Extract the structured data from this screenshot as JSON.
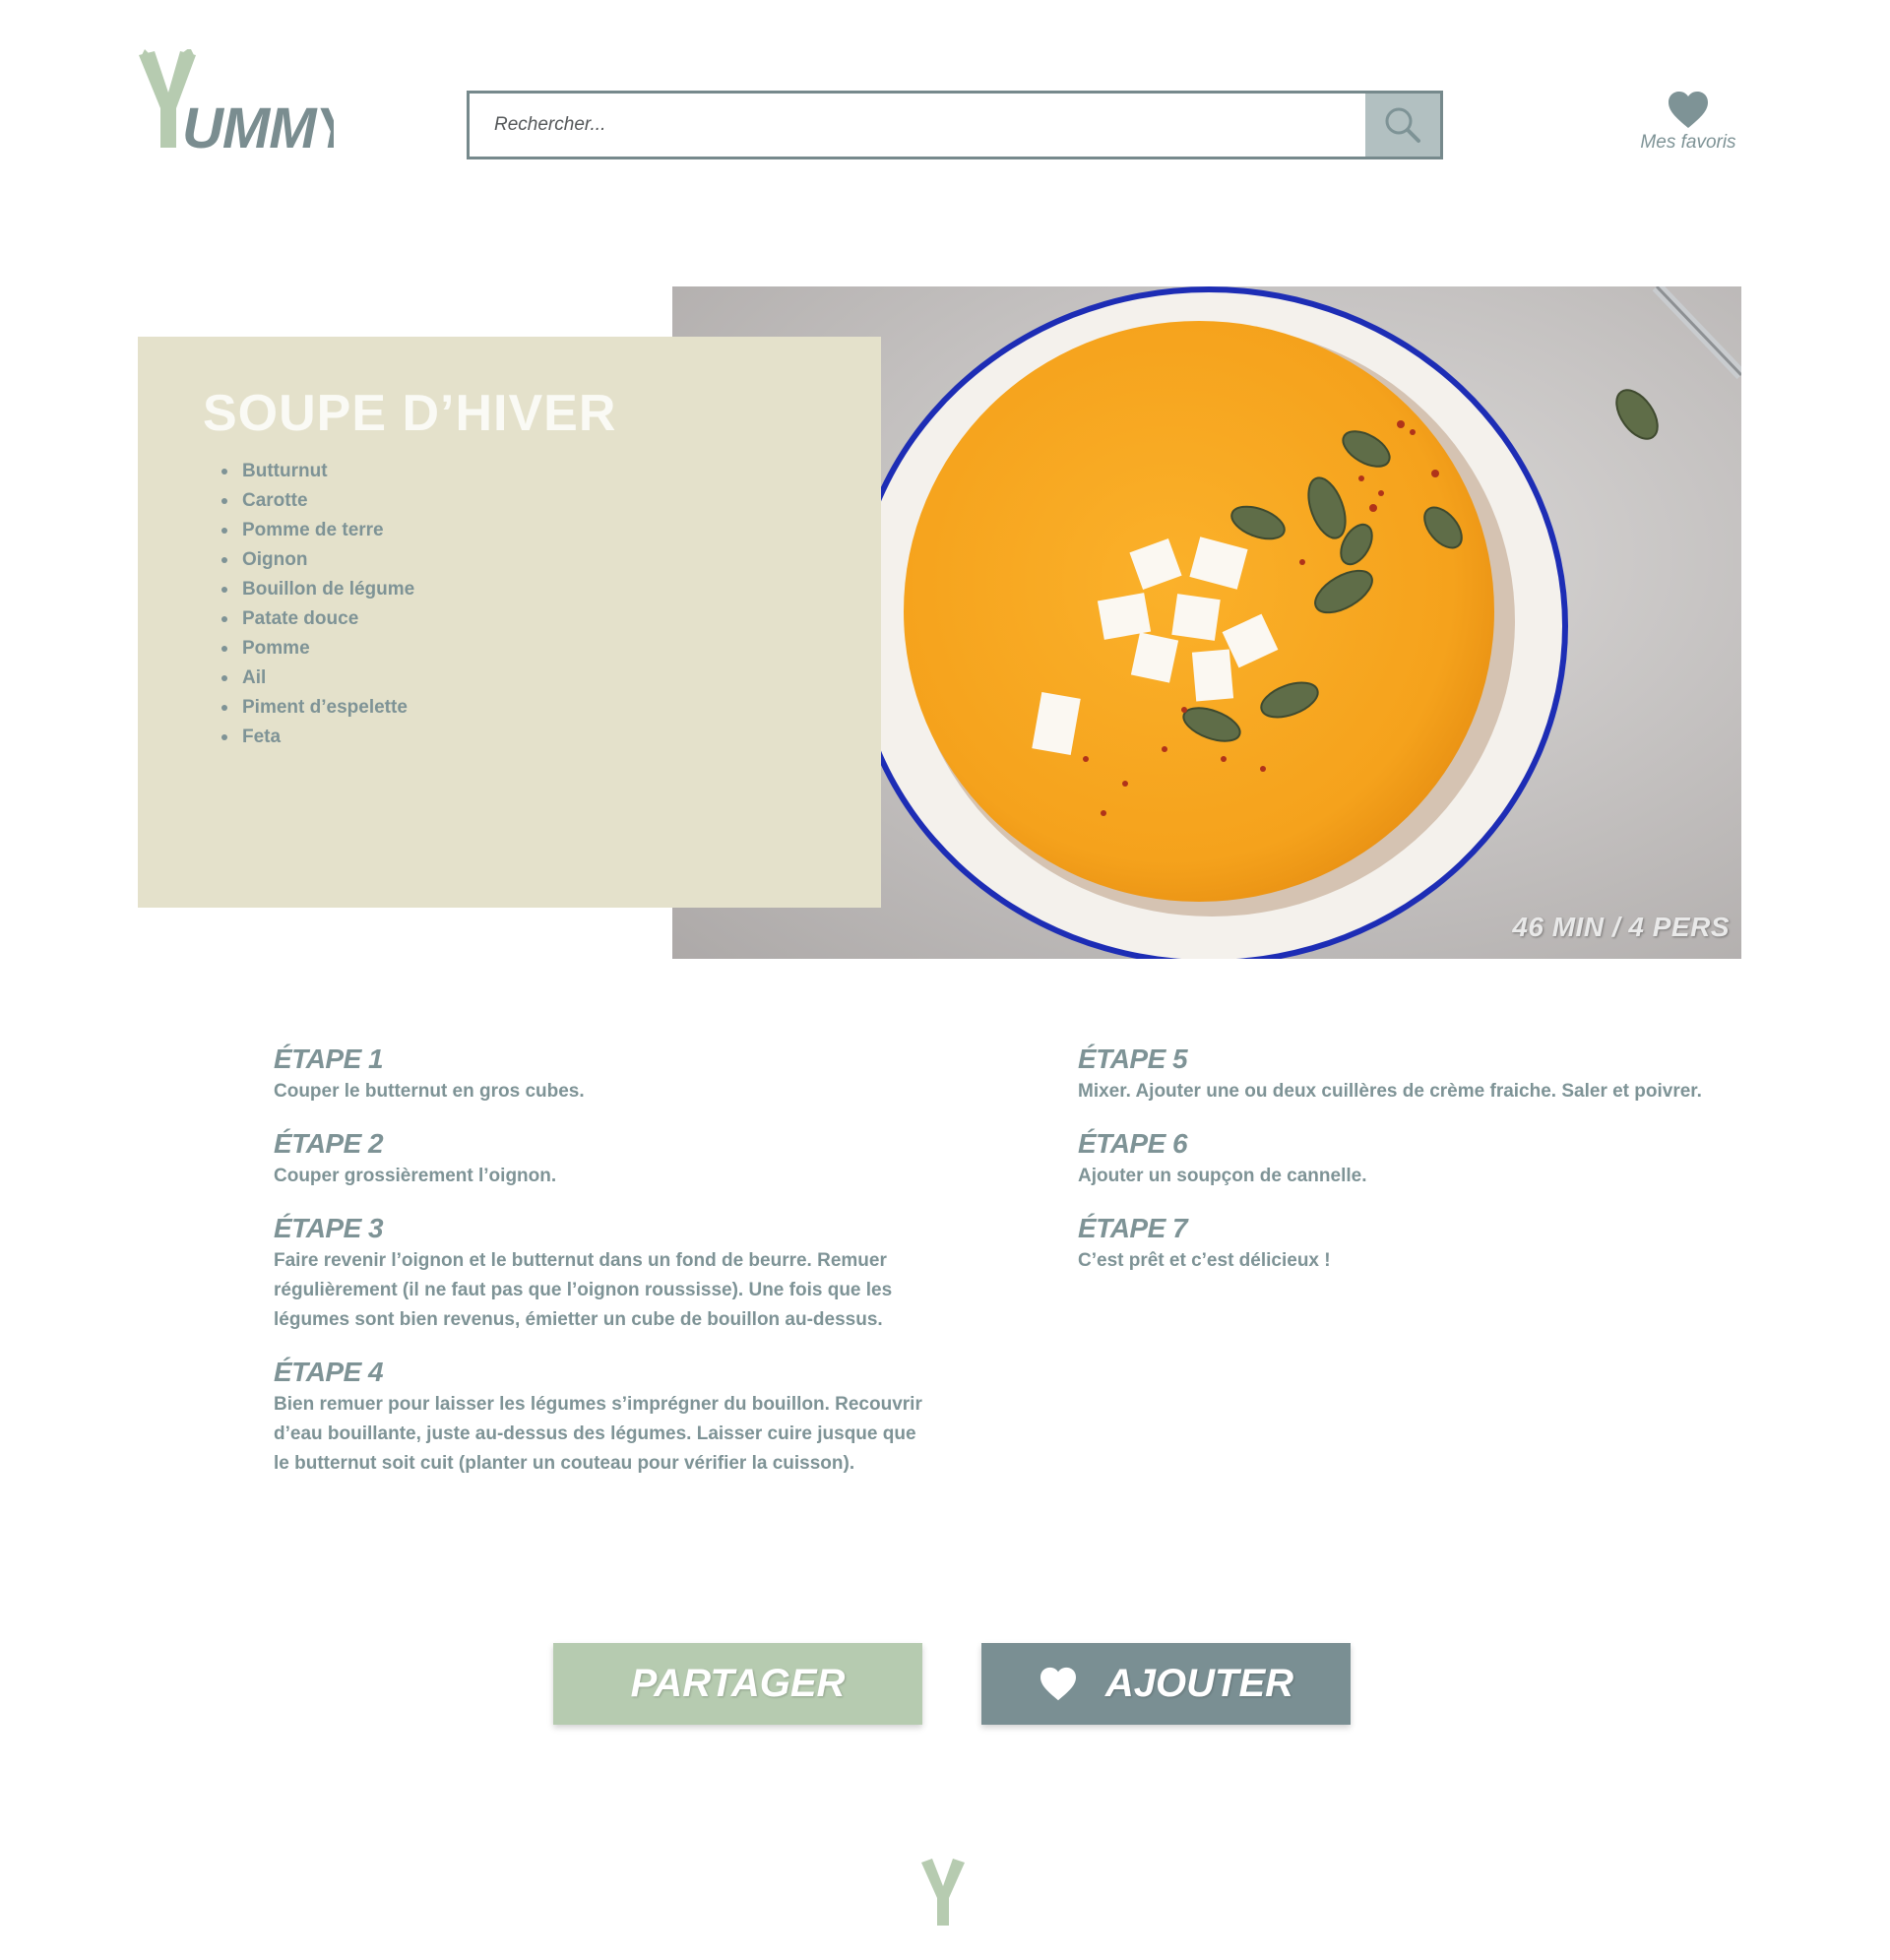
{
  "header": {
    "logo_text": "YUMMY",
    "search": {
      "placeholder": "Rechercher..."
    },
    "favorites_label": "Mes favoris"
  },
  "recipe": {
    "title": "SOUPE D’HIVER",
    "meta": "46 MIN / 4 PERS",
    "ingredients": [
      "Butturnut",
      "Carotte",
      "Pomme de terre",
      "Oignon",
      "Bouillon de légume",
      "Patate douce",
      "Pomme",
      "Ail",
      "Piment d’espelette",
      "Feta"
    ]
  },
  "steps": [
    {
      "title": "ÉTAPE 1",
      "text": "Couper le butternut en gros cubes."
    },
    {
      "title": "ÉTAPE 2",
      "text": "Couper grossièrement l’oignon."
    },
    {
      "title": "ÉTAPE 3",
      "text": "Faire revenir l’oignon et le butternut dans un fond de beurre. Remuer régulièrement (il ne faut pas que l’oignon roussisse). Une fois que les légumes sont bien revenus, émietter un cube de bouillon au-dessus."
    },
    {
      "title": "ÉTAPE 4",
      "text": "Bien remuer pour laisser les légumes s’imprégner du bouillon. Recouvrir d’eau bouillante, juste au-dessus des légumes. Laisser cuire jusque que le butternut soit cuit (planter un couteau pour vérifier la cuisson)."
    },
    {
      "title": "ÉTAPE 5",
      "text": "Mixer. Ajouter une ou deux cuillères de crème fraiche. Saler et poivrer."
    },
    {
      "title": "ÉTAPE 6",
      "text": "Ajouter un soupçon de cannelle."
    },
    {
      "title": "ÉTAPE 7",
      "text": "C’est prêt et c’est délicieux !"
    }
  ],
  "actions": {
    "share_label": "PARTAGER",
    "add_label": "AJOUTER"
  },
  "icons": {
    "search": "search-icon",
    "favorites": "heart-icon",
    "add": "heart-icon"
  },
  "colors": {
    "slate": "#7e9396",
    "sage": "#b6cbb0",
    "card_beige": "#e4e1cb",
    "search_button": "#b2c0c1",
    "add_button": "#7a8f93"
  }
}
